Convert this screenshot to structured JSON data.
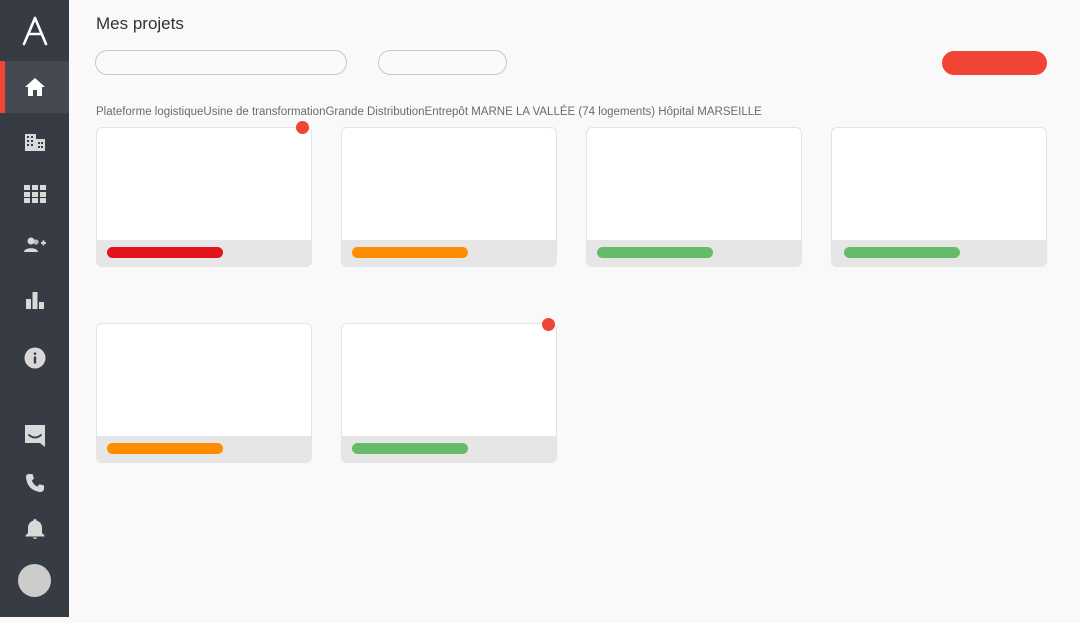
{
  "app": {
    "logo_letter": "A"
  },
  "sidebar": {
    "items": [
      {
        "name": "home-icon",
        "active": true
      },
      {
        "name": "building-icon",
        "active": false
      },
      {
        "name": "grid-icon",
        "active": false
      },
      {
        "name": "add-user-icon",
        "active": false
      },
      {
        "name": "bar-chart-icon",
        "active": false
      },
      {
        "name": "info-icon",
        "active": false
      }
    ],
    "bottom_items": [
      {
        "name": "chat-icon"
      },
      {
        "name": "phone-icon"
      },
      {
        "name": "bell-icon"
      },
      {
        "name": "avatar"
      }
    ]
  },
  "header": {
    "title": "Mes projets"
  },
  "filters": {
    "search_placeholder": "",
    "select_value": "",
    "new_button_label": ""
  },
  "projects_line": "Plateforme logistiqueUsine de transformationGrande DistributionEntrepôt MARNE LA VALLÉE (74 logements) Hôpital MARSEILLE",
  "colors": {
    "accent": "#f04535",
    "sidebar": "#373b43",
    "status_red": "#e3131b",
    "status_orange": "#ff8c00",
    "status_green": "#66bb6a"
  },
  "cards": [
    {
      "status": "red",
      "notification": true
    },
    {
      "status": "orange",
      "notification": false
    },
    {
      "status": "green",
      "notification": false
    },
    {
      "status": "green",
      "notification": false
    },
    {
      "status": "orange",
      "notification": false
    },
    {
      "status": "green",
      "notification": true
    }
  ]
}
